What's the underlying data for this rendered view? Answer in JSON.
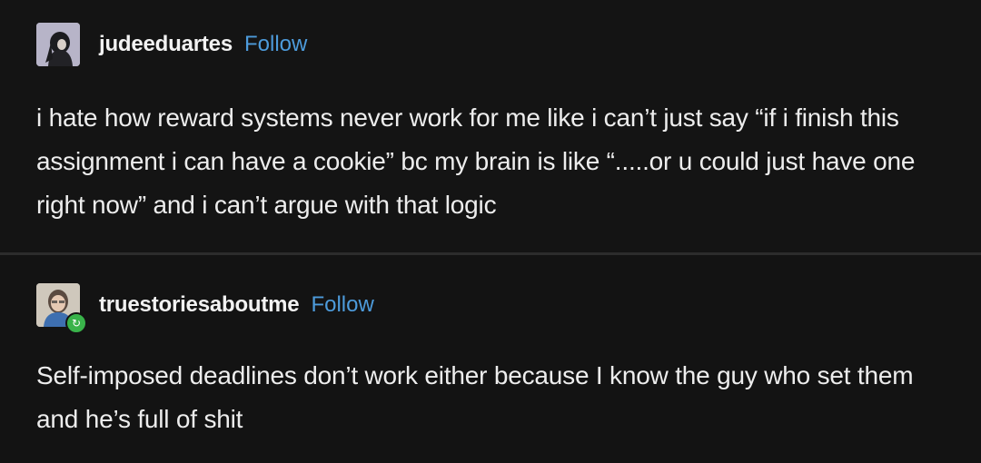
{
  "posts": [
    {
      "username": "judeeduartes",
      "follow_label": "Follow",
      "avatar_icon": "user-avatar-icon",
      "text": "i hate how reward systems never work for me like i can’t just say “if i finish this assignment i can have a cookie” bc my brain is like “.....or u could just have one right now” and i can’t argue with that logic"
    },
    {
      "username": "truestoriesaboutme",
      "follow_label": "Follow",
      "avatar_icon": "user-avatar-icon",
      "badge_icon": "reblog-icon",
      "text": "Self-imposed deadlines don’t work either because I know the guy who set them and he’s full of shit"
    }
  ],
  "colors": {
    "background": "#141414",
    "text": "#ededed",
    "follow_link": "#4d9bdb",
    "divider": "#2c2c2c",
    "badge": "#39b34a"
  }
}
